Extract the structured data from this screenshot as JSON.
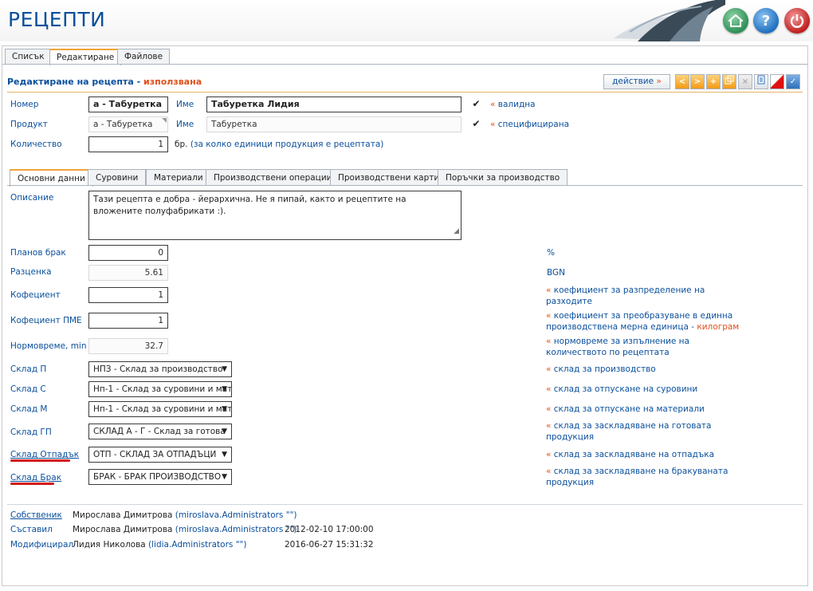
{
  "app": {
    "title": "РЕЦЕПТИ"
  },
  "header_buttons": {
    "home": "home-icon",
    "help": "?",
    "exit": "power-icon"
  },
  "top_tabs": [
    "Списък",
    "Редактиране",
    "Файлове"
  ],
  "edit": {
    "title": "Редактиране на рецепта",
    "status": "използвана",
    "action_label": "действие",
    "action_arrow": "»"
  },
  "toolbar": {
    "prev": "<",
    "next": ">",
    "add": "+",
    "copy": "copy-icon",
    "delete": "×",
    "print": "print-icon",
    "cancel": "cancel-icon",
    "save": "✓"
  },
  "form": {
    "number_label": "Номер",
    "number_value": "а - Табуретка",
    "name_label": "Име",
    "name_value": "Табуретка Лидия",
    "valid_quote": "«",
    "valid_label": "валидна",
    "product_label": "Продукт",
    "product_value": "а - Табуретка",
    "product_name_label": "Име",
    "product_name_value": "Табуретка",
    "specified_quote": "«",
    "specified_label": "специфицирана",
    "quantity_label": "Количество",
    "quantity_value": "1",
    "quantity_unit": "бр.",
    "quantity_note": "(за колко единици продукция е рецептата)"
  },
  "section_tabs": [
    "Основни данни",
    "Суровини",
    "Материали",
    "Производствени операции",
    "Производствени карти",
    "Поръчки за производство"
  ],
  "basic": {
    "description_label": "Описание",
    "description_value": "Тази рецепта е добра - йерархична. Не я пипай, както и рецептите на вложените полуфабрикати :).",
    "scrap_label": "Планов брак",
    "scrap_value": "0",
    "scrap_unit": "%",
    "cost_label": "Разценка",
    "cost_value": "5.61",
    "cost_unit": "BGN",
    "coef_label": "Кофециент",
    "coef_value": "1",
    "coef_note_q": "«",
    "coef_note_1": "коефициент за разпределение на",
    "coef_note_2": "разходите",
    "coef_pme_label": "Кофециент ПМЕ",
    "coef_pme_value": "1",
    "coef_pme_note_q": "«",
    "coef_pme_note_1": "коефициент за преобразуване в единна",
    "coef_pme_note_2": "производствена мерна единица -",
    "coef_pme_note_unit": "килограм",
    "norm_label": "Нормовреме, min",
    "norm_value": "32.7",
    "norm_note_q": "«",
    "norm_note_1": "нормовреме за изпълнение на",
    "norm_note_2": "количеството по рецептата"
  },
  "warehouses": [
    {
      "label": "Склад П",
      "value": "НПЗ - Склад за производство",
      "note_1": "склад за производство",
      "note_2": ""
    },
    {
      "label": "Склад С",
      "value": "Нп-1 - Склад за суровини и мат",
      "note_1": "склад за отпускане на суровини",
      "note_2": ""
    },
    {
      "label": "Склад М",
      "value": "Нп-1 - Склад за суровини и мат",
      "note_1": "склад за отпускане на материали",
      "note_2": ""
    },
    {
      "label": "Склад ГП",
      "value": "СКЛАД А - Г - Склад за готова",
      "note_1": "склад за заскладяване на готовата",
      "note_2": "продукция"
    },
    {
      "label": "Склад Отпадък",
      "value": "ОТП - СКЛАД ЗА ОТПАДЪЦИ",
      "note_1": "склад за заскладяване на отпадъка",
      "note_2": ""
    },
    {
      "label": "Склад Брак",
      "value": "БРАК - БРАК ПРОИЗВОДСТВО",
      "note_1": "склад за заскладяване на бракуваната",
      "note_2": "продукция"
    }
  ],
  "warehouse_note_quote": "«",
  "meta": {
    "owner_label": "Собственик",
    "owner_name": "Мирослава Димитрова",
    "owner_account": "(miroslava.Administrators \"\")",
    "creator_label": "Съставил",
    "creator_name": "Мирослава Димитрова",
    "creator_account": "(miroslava.Administrators \"\")",
    "creator_time": "2012-02-10 17:00:00",
    "modifier_label": "Модифицирал",
    "modifier_name": "Лидия Николова",
    "modifier_account": "(lidia.Administrators \"\")",
    "modifier_time": "2016-06-27 15:31:32"
  },
  "colors": {
    "accent": "#0a4f9c",
    "highlight": "#e0501a",
    "underline_mark": "#d1141b",
    "tab_active": "#f0a43a"
  }
}
